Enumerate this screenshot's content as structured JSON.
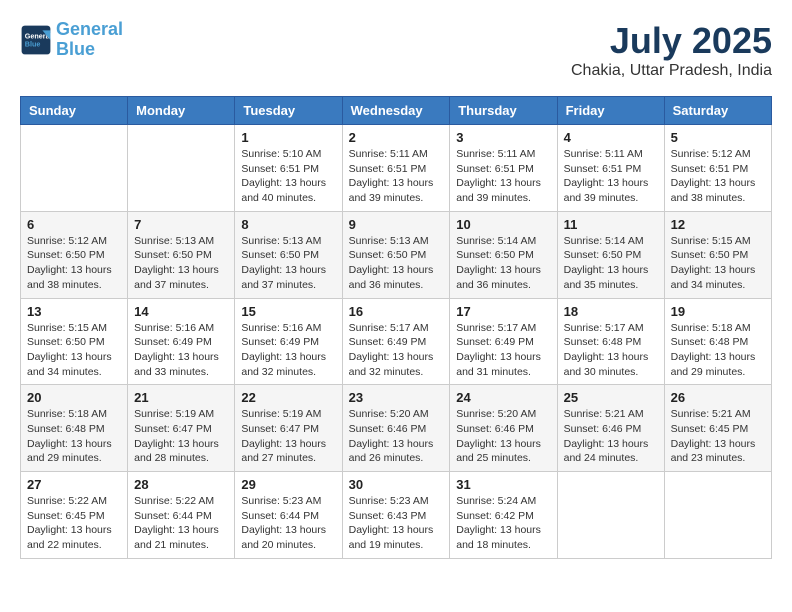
{
  "logo": {
    "line1": "General",
    "line2": "Blue"
  },
  "header": {
    "month": "July 2025",
    "location": "Chakia, Uttar Pradesh, India"
  },
  "weekdays": [
    "Sunday",
    "Monday",
    "Tuesday",
    "Wednesday",
    "Thursday",
    "Friday",
    "Saturday"
  ],
  "weeks": [
    [
      {
        "day": "",
        "info": ""
      },
      {
        "day": "",
        "info": ""
      },
      {
        "day": "1",
        "info": "Sunrise: 5:10 AM\nSunset: 6:51 PM\nDaylight: 13 hours and 40 minutes."
      },
      {
        "day": "2",
        "info": "Sunrise: 5:11 AM\nSunset: 6:51 PM\nDaylight: 13 hours and 39 minutes."
      },
      {
        "day": "3",
        "info": "Sunrise: 5:11 AM\nSunset: 6:51 PM\nDaylight: 13 hours and 39 minutes."
      },
      {
        "day": "4",
        "info": "Sunrise: 5:11 AM\nSunset: 6:51 PM\nDaylight: 13 hours and 39 minutes."
      },
      {
        "day": "5",
        "info": "Sunrise: 5:12 AM\nSunset: 6:51 PM\nDaylight: 13 hours and 38 minutes."
      }
    ],
    [
      {
        "day": "6",
        "info": "Sunrise: 5:12 AM\nSunset: 6:50 PM\nDaylight: 13 hours and 38 minutes."
      },
      {
        "day": "7",
        "info": "Sunrise: 5:13 AM\nSunset: 6:50 PM\nDaylight: 13 hours and 37 minutes."
      },
      {
        "day": "8",
        "info": "Sunrise: 5:13 AM\nSunset: 6:50 PM\nDaylight: 13 hours and 37 minutes."
      },
      {
        "day": "9",
        "info": "Sunrise: 5:13 AM\nSunset: 6:50 PM\nDaylight: 13 hours and 36 minutes."
      },
      {
        "day": "10",
        "info": "Sunrise: 5:14 AM\nSunset: 6:50 PM\nDaylight: 13 hours and 36 minutes."
      },
      {
        "day": "11",
        "info": "Sunrise: 5:14 AM\nSunset: 6:50 PM\nDaylight: 13 hours and 35 minutes."
      },
      {
        "day": "12",
        "info": "Sunrise: 5:15 AM\nSunset: 6:50 PM\nDaylight: 13 hours and 34 minutes."
      }
    ],
    [
      {
        "day": "13",
        "info": "Sunrise: 5:15 AM\nSunset: 6:50 PM\nDaylight: 13 hours and 34 minutes."
      },
      {
        "day": "14",
        "info": "Sunrise: 5:16 AM\nSunset: 6:49 PM\nDaylight: 13 hours and 33 minutes."
      },
      {
        "day": "15",
        "info": "Sunrise: 5:16 AM\nSunset: 6:49 PM\nDaylight: 13 hours and 32 minutes."
      },
      {
        "day": "16",
        "info": "Sunrise: 5:17 AM\nSunset: 6:49 PM\nDaylight: 13 hours and 32 minutes."
      },
      {
        "day": "17",
        "info": "Sunrise: 5:17 AM\nSunset: 6:49 PM\nDaylight: 13 hours and 31 minutes."
      },
      {
        "day": "18",
        "info": "Sunrise: 5:17 AM\nSunset: 6:48 PM\nDaylight: 13 hours and 30 minutes."
      },
      {
        "day": "19",
        "info": "Sunrise: 5:18 AM\nSunset: 6:48 PM\nDaylight: 13 hours and 29 minutes."
      }
    ],
    [
      {
        "day": "20",
        "info": "Sunrise: 5:18 AM\nSunset: 6:48 PM\nDaylight: 13 hours and 29 minutes."
      },
      {
        "day": "21",
        "info": "Sunrise: 5:19 AM\nSunset: 6:47 PM\nDaylight: 13 hours and 28 minutes."
      },
      {
        "day": "22",
        "info": "Sunrise: 5:19 AM\nSunset: 6:47 PM\nDaylight: 13 hours and 27 minutes."
      },
      {
        "day": "23",
        "info": "Sunrise: 5:20 AM\nSunset: 6:46 PM\nDaylight: 13 hours and 26 minutes."
      },
      {
        "day": "24",
        "info": "Sunrise: 5:20 AM\nSunset: 6:46 PM\nDaylight: 13 hours and 25 minutes."
      },
      {
        "day": "25",
        "info": "Sunrise: 5:21 AM\nSunset: 6:46 PM\nDaylight: 13 hours and 24 minutes."
      },
      {
        "day": "26",
        "info": "Sunrise: 5:21 AM\nSunset: 6:45 PM\nDaylight: 13 hours and 23 minutes."
      }
    ],
    [
      {
        "day": "27",
        "info": "Sunrise: 5:22 AM\nSunset: 6:45 PM\nDaylight: 13 hours and 22 minutes."
      },
      {
        "day": "28",
        "info": "Sunrise: 5:22 AM\nSunset: 6:44 PM\nDaylight: 13 hours and 21 minutes."
      },
      {
        "day": "29",
        "info": "Sunrise: 5:23 AM\nSunset: 6:44 PM\nDaylight: 13 hours and 20 minutes."
      },
      {
        "day": "30",
        "info": "Sunrise: 5:23 AM\nSunset: 6:43 PM\nDaylight: 13 hours and 19 minutes."
      },
      {
        "day": "31",
        "info": "Sunrise: 5:24 AM\nSunset: 6:42 PM\nDaylight: 13 hours and 18 minutes."
      },
      {
        "day": "",
        "info": ""
      },
      {
        "day": "",
        "info": ""
      }
    ]
  ]
}
